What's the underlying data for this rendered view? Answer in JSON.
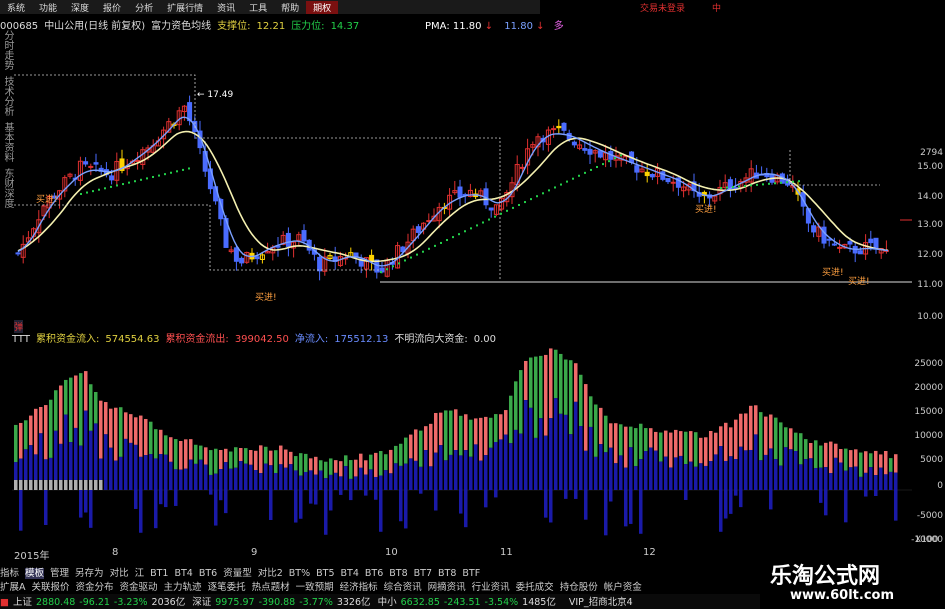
{
  "menu": {
    "items": [
      "系统",
      "功能",
      "深度",
      "报价",
      "分析",
      "扩展行情",
      "资讯",
      "工具",
      "帮助",
      "期权"
    ],
    "active_index": 9,
    "right_labels": [
      "交易未登录",
      "中"
    ]
  },
  "info": {
    "code": "000685",
    "name": "中山公用(日线 前复权)",
    "indicator": "富力资色均线",
    "support_label": "支撑位:",
    "support_value": "12.21",
    "pressure_label": "压力位:",
    "pressure_value": "14.37",
    "pma_label": "PMA:",
    "pma_value": "11.80",
    "pma_value2": "11.80",
    "pma_suffix": "多"
  },
  "side_tabs": [
    "分时走势",
    "技术分析",
    "基本资料",
    "东财深度"
  ],
  "main_chart": {
    "peak_label": "17.49",
    "buy_label": "买进!",
    "y_ticks": [
      "2794",
      "15.00",
      "14.00",
      "13.00",
      "12.00",
      "11.00",
      "10.00"
    ],
    "colors": {
      "up": "#e03030",
      "down": "#4a6cff",
      "ma_white": "#f4f0b0",
      "ma_blue": "#7aa0ff",
      "dots": "#22d04a",
      "yellow": "#ffd400"
    }
  },
  "flow": {
    "tag": "弹",
    "ttt": "TTT",
    "inflow_label": "累积资金流入:",
    "inflow_value": "574554.63",
    "outflow_label": "累积资金流出:",
    "outflow_value": "399042.50",
    "net_label": "净流入:",
    "net_value": "175512.13",
    "unknown_label": "不明流向大资金:",
    "unknown_value": "0.00"
  },
  "sub_chart": {
    "y_ticks": [
      "25000",
      "20000",
      "15000",
      "10000",
      "5000",
      "0",
      "-5000",
      "-10000"
    ],
    "unit": "X100"
  },
  "date_axis": {
    "labels": [
      "2015年",
      "8",
      "9",
      "10",
      "11",
      "12"
    ]
  },
  "bottom_tabs1": [
    "指标",
    "模板",
    "管理",
    "另存为",
    "对比",
    "江",
    "BT1",
    "BT4",
    "BT6",
    "资量型",
    "对比2",
    "BT%",
    "BT5",
    "BT4",
    "BT6",
    "BT8",
    "BT7",
    "BT8",
    "BTF"
  ],
  "bottom_tabs1_active": 1,
  "bottom_tabs2": [
    "扩展A",
    "关联报价",
    "资金分布",
    "资金驱动",
    "主力轨迹",
    "逐笔委托",
    "热点题材",
    "一致预期",
    "经济指标",
    "综合资讯",
    "网摘资讯",
    "行业资讯",
    "委托成交",
    "持仓股份",
    "帐户资金"
  ],
  "status": {
    "sh_label": "上证",
    "sh_value": "2880.48",
    "sh_change": "-96.21",
    "sh_pct": "-3.23%",
    "sh_amount": "2036亿",
    "sz_label": "深证",
    "sz_value": "9975.97",
    "sz_change": "-390.88",
    "sz_pct": "-3.77%",
    "sz_amount": "3326亿",
    "zx_label": "中小",
    "zx_value": "6632.85",
    "zx_change": "-243.51",
    "zx_pct": "-3.54%",
    "zx_amount": "1485亿",
    "vip": "VIP_招商北京4"
  },
  "watermark": {
    "title": "乐淘公式网",
    "url": "www.60lt.com"
  }
}
